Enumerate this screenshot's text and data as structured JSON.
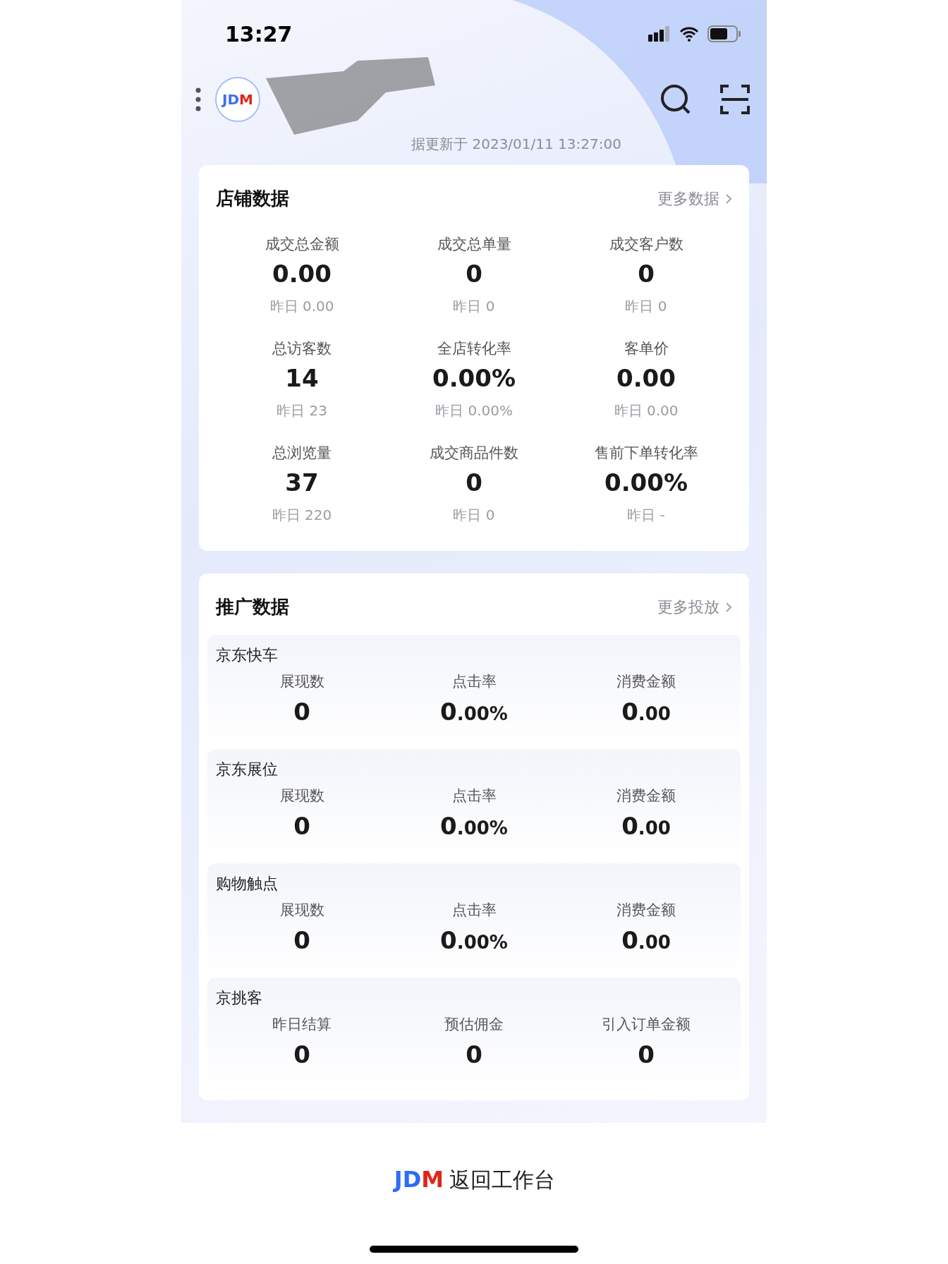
{
  "status_bar": {
    "time": "13:27"
  },
  "header": {
    "logo": "JDM",
    "updated": "据更新于 2023/01/11 13:27:00"
  },
  "store_card": {
    "title": "店铺数据",
    "more": "更多数据",
    "metrics": [
      {
        "label": "成交总金额",
        "value": "0.00",
        "yesterday": "昨日 0.00"
      },
      {
        "label": "成交总单量",
        "value": "0",
        "yesterday": "昨日 0"
      },
      {
        "label": "成交客户数",
        "value": "0",
        "yesterday": "昨日 0"
      },
      {
        "label": "总访客数",
        "value": "14",
        "yesterday": "昨日 23"
      },
      {
        "label": "全店转化率",
        "value": "0.00%",
        "yesterday": "昨日 0.00%"
      },
      {
        "label": "客单价",
        "value": "0.00",
        "yesterday": "昨日 0.00"
      },
      {
        "label": "总浏览量",
        "value": "37",
        "yesterday": "昨日 220"
      },
      {
        "label": "成交商品件数",
        "value": "0",
        "yesterday": "昨日 0"
      },
      {
        "label": "售前下单转化率",
        "value": "0.00%",
        "yesterday": "昨日 -"
      }
    ]
  },
  "promo_card": {
    "title": "推广数据",
    "more": "更多投放",
    "sections": [
      {
        "title": "京东快车",
        "metrics": [
          {
            "label": "展现数",
            "value": "0"
          },
          {
            "label": "点击率",
            "value": "0.00%"
          },
          {
            "label": "消费金额",
            "value": "0.00"
          }
        ]
      },
      {
        "title": "京东展位",
        "metrics": [
          {
            "label": "展现数",
            "value": "0"
          },
          {
            "label": "点击率",
            "value": "0.00%"
          },
          {
            "label": "消费金额",
            "value": "0.00"
          }
        ]
      },
      {
        "title": "购物触点",
        "metrics": [
          {
            "label": "展现数",
            "value": "0"
          },
          {
            "label": "点击率",
            "value": "0.00%"
          },
          {
            "label": "消费金额",
            "value": "0.00"
          }
        ]
      },
      {
        "title": "京挑客",
        "metrics": [
          {
            "label": "昨日结算",
            "value": "0"
          },
          {
            "label": "预估佣金",
            "value": "0"
          },
          {
            "label": "引入订单金额",
            "value": "0"
          }
        ]
      }
    ]
  },
  "footer": {
    "logo": "JDM",
    "label": "返回工作台"
  }
}
